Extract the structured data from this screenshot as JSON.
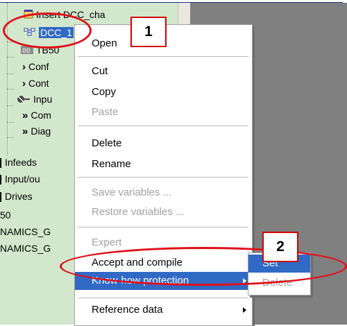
{
  "tree": {
    "items": [
      {
        "label": "Insert DCC_cha",
        "icon": "chart-icon"
      },
      {
        "label": "DCC_1",
        "icon": "dcc-chart-icon",
        "selected": true
      },
      {
        "label": "TB50",
        "icon": "tb-icon"
      },
      {
        "label": "Conf",
        "icon": "chevron-right-icon"
      },
      {
        "label": "Cont",
        "icon": "chevron-right-icon"
      },
      {
        "label": "Inpu",
        "icon": "connector-icon"
      },
      {
        "label": "Com",
        "icon": "double-chevron-icon"
      },
      {
        "label": "Diag",
        "icon": "double-chevron-icon"
      },
      {
        "label": "Infeeds"
      },
      {
        "label": "Input/ou"
      },
      {
        "label": "Drives"
      },
      {
        "label": "50"
      },
      {
        "label": "NAMICS_G"
      },
      {
        "label": "NAMICS_G"
      }
    ]
  },
  "context_menu": {
    "open": "Open",
    "cut": "Cut",
    "copy": "Copy",
    "paste": "Paste",
    "delete": "Delete",
    "rename": "Rename",
    "save_variables": "Save variables ...",
    "restore_variables": "Restore variables ...",
    "expert": "Expert",
    "accept_compile": "Accept and compile",
    "know_how": "Know-how protection",
    "reference_data": "Reference data"
  },
  "submenu": {
    "set": "Set",
    "delete": "Delete"
  },
  "callouts": {
    "one": "1",
    "two": "2"
  },
  "colors": {
    "highlight": "#316ac5",
    "tree_bg": "#d3e7cc",
    "annotation_red": "#e0101a"
  }
}
